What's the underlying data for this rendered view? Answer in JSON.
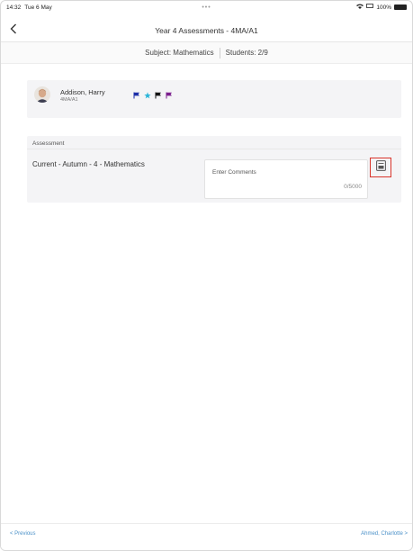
{
  "status_bar": {
    "time": "14:32",
    "date": "Tue 6 May",
    "dots": "•••",
    "battery": "100%"
  },
  "navbar": {
    "title": "Year 4 Assessments - 4MA/A1"
  },
  "subheader": {
    "subject": "Subject: Mathematics",
    "students": "Students: 2/9"
  },
  "student": {
    "name": "Addison, Harry",
    "class": "4MA/A1",
    "flags": [
      {
        "icon": "flag-icon",
        "color": "#1c2ea8"
      },
      {
        "icon": "star-icon",
        "color": "#2bb5d9"
      },
      {
        "icon": "flag-icon",
        "color": "#111111"
      },
      {
        "icon": "flag-icon",
        "color": "#7a1d8c"
      }
    ]
  },
  "assessment": {
    "label": "Assessment",
    "name": "Current - Autumn - 4 - Mathematics",
    "comment_placeholder": "Enter Comments",
    "comment_counter": "0/5000",
    "comment_button_icon": "comment-bank-icon",
    "highlight_color": "#d9342b"
  },
  "footer": {
    "previous": "< Previous",
    "next": "Ahmed, Charlotte >"
  },
  "colors": {
    "link": "#4a90c8",
    "card": "#f4f4f6"
  }
}
